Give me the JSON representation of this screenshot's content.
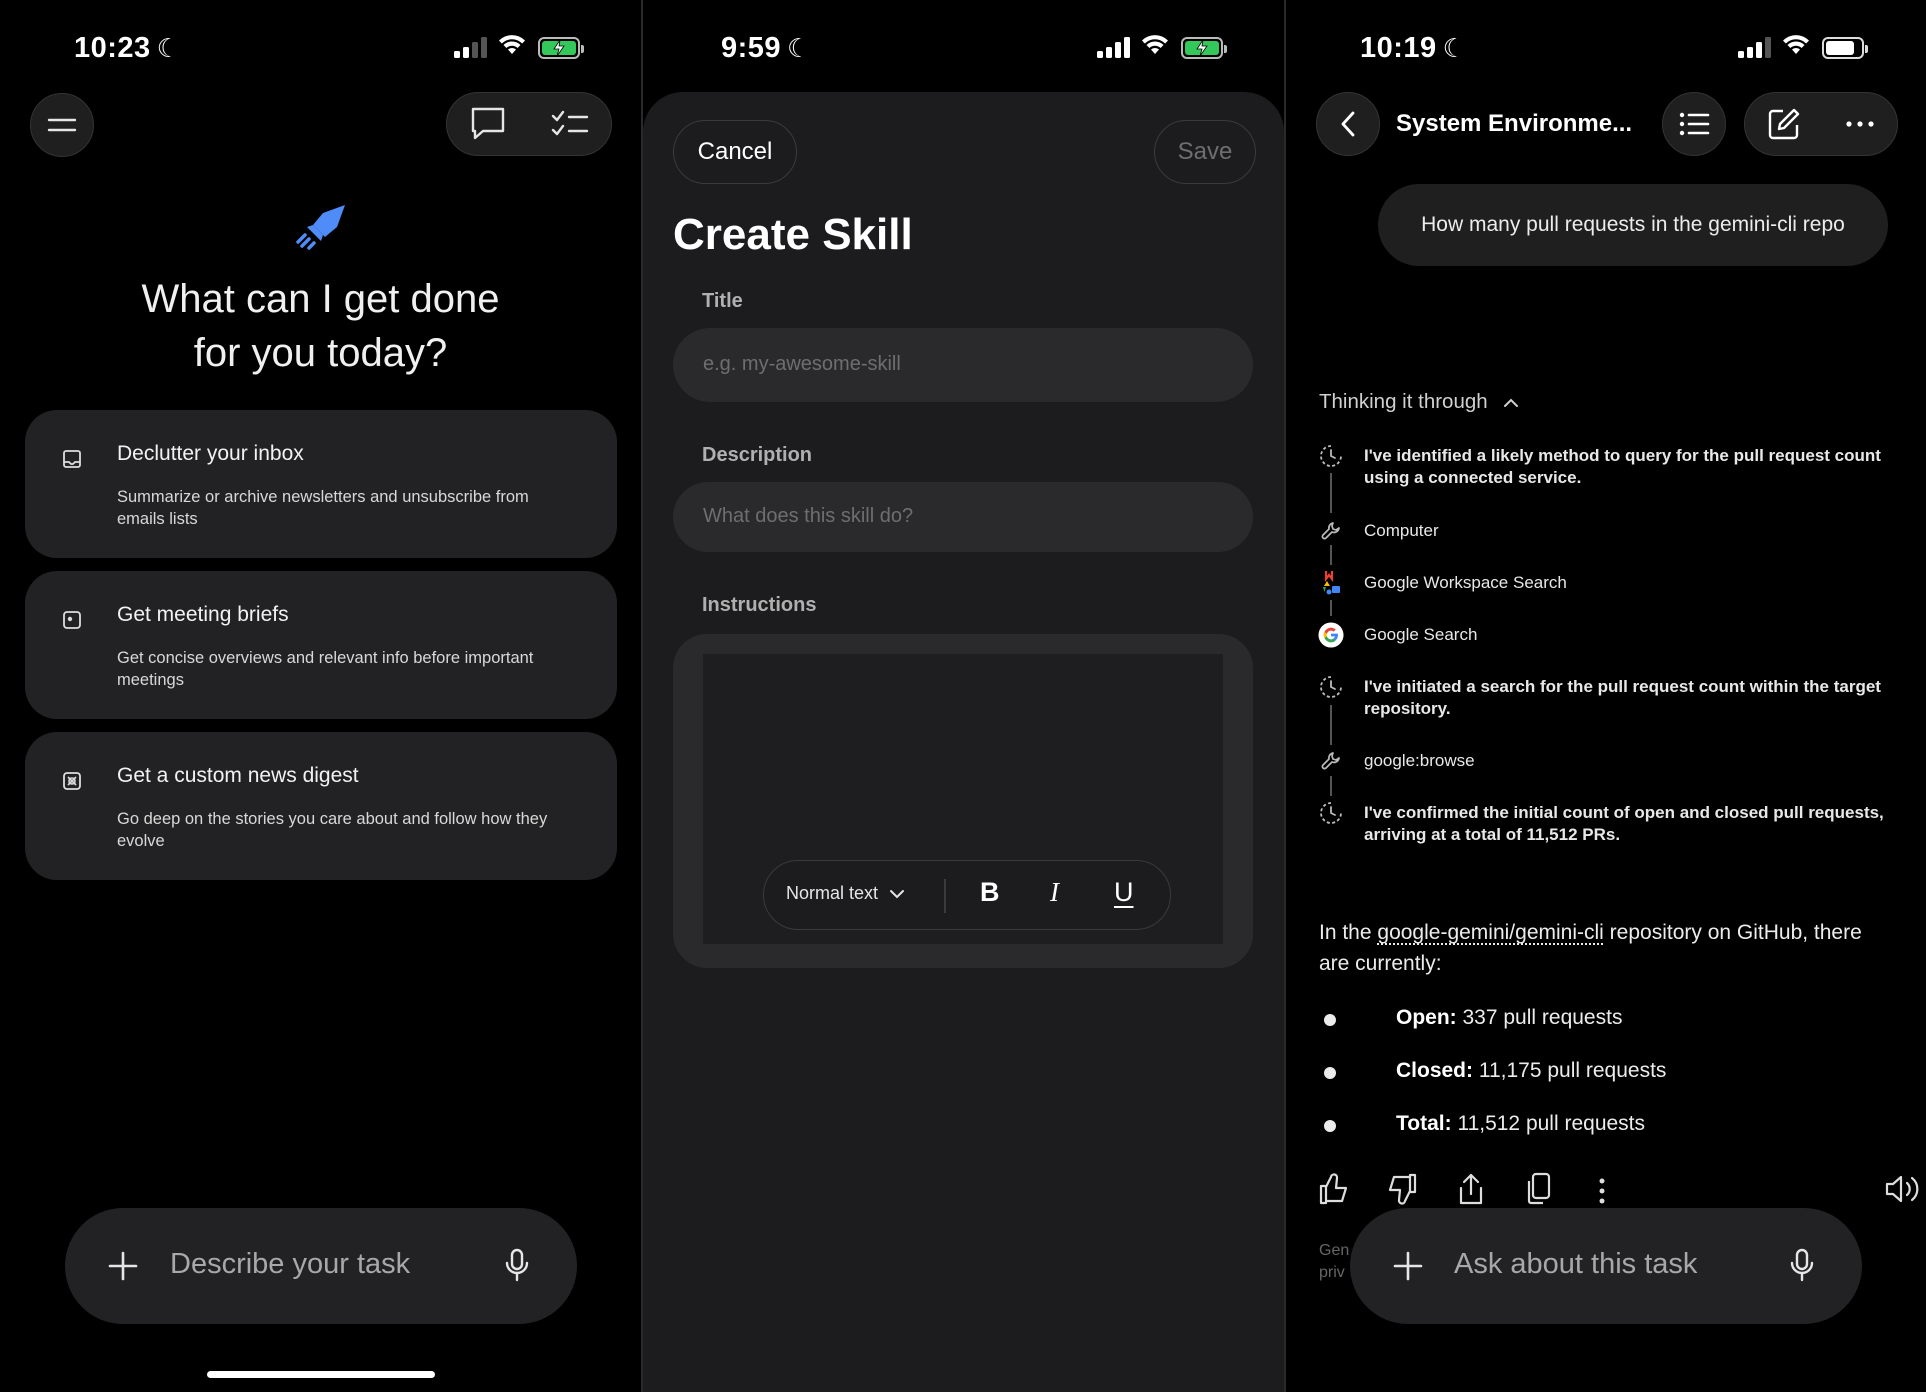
{
  "panel_home": {
    "status": {
      "time": "10:23"
    },
    "header": {
      "menu_icon": "hamburger-icon",
      "chat_icon": "chat-bubble-icon",
      "tasks_icon": "checklist-icon"
    },
    "hero": {
      "line1": "What can I get done",
      "line2": "for you today?"
    },
    "cards": [
      {
        "icon": "inbox-icon",
        "title": "Declutter your inbox",
        "description": "Summarize or archive newsletters and unsubscribe from emails lists"
      },
      {
        "icon": "meeting-icon",
        "title": "Get meeting briefs",
        "description": "Get concise overviews and relevant info before important meetings"
      },
      {
        "icon": "news-icon",
        "title": "Get a custom news digest",
        "description": "Go deep on the stories you care about and follow how they evolve"
      }
    ],
    "composer": {
      "placeholder": "Describe your task"
    }
  },
  "panel_create_skill": {
    "status": {
      "time": "9:59"
    },
    "cancel_label": "Cancel",
    "save_label": "Save",
    "title": "Create Skill",
    "fields": {
      "title_label": "Title",
      "title_placeholder": "e.g. my-awesome-skill",
      "description_label": "Description",
      "description_placeholder": "What does this skill do?",
      "instructions_label": "Instructions"
    },
    "toolbar": {
      "style_label": "Normal text",
      "bold": "B",
      "italic": "I",
      "underline": "U"
    }
  },
  "panel_task": {
    "status": {
      "time": "10:19"
    },
    "title": "System Environme...",
    "user_message": "How many pull requests in the gemini-cli repo",
    "thinking_header": "Thinking it through",
    "steps": [
      {
        "icon": "thinking-icon",
        "text": "I've identified a likely method to query for the pull request count using a connected service.",
        "bold": true
      },
      {
        "icon": "wrench-icon",
        "text": "Computer",
        "bold": false
      },
      {
        "icon": "workspace-icon",
        "text": "Google Workspace Search",
        "bold": false
      },
      {
        "icon": "google-icon",
        "text": "Google Search",
        "bold": false
      },
      {
        "icon": "thinking-icon",
        "text": "I've initiated a search for the pull request count within the target repository.",
        "bold": true
      },
      {
        "icon": "wrench-icon",
        "text": "google:browse",
        "bold": false
      },
      {
        "icon": "thinking-icon",
        "text": "I've confirmed the initial count of open and closed pull requests, arriving at a total of 11,512 PRs.",
        "bold": true
      }
    ],
    "answer": {
      "prefix": "In the ",
      "link": "google-gemini/gemini-cli",
      "suffix": " repository on GitHub, there are currently:"
    },
    "bullets": [
      {
        "label": "Open:",
        "value": " 337 pull requests"
      },
      {
        "label": "Closed:",
        "value": " 11,175 pull requests"
      },
      {
        "label": "Total:",
        "value": " 11,512 pull requests"
      }
    ],
    "fine_print": "Gen\npriv",
    "composer": {
      "placeholder": "Ask about this task"
    }
  },
  "colors": {
    "accent_blue": "#4f8cf7",
    "battery_green": "#34c759",
    "card_bg": "#222224"
  }
}
